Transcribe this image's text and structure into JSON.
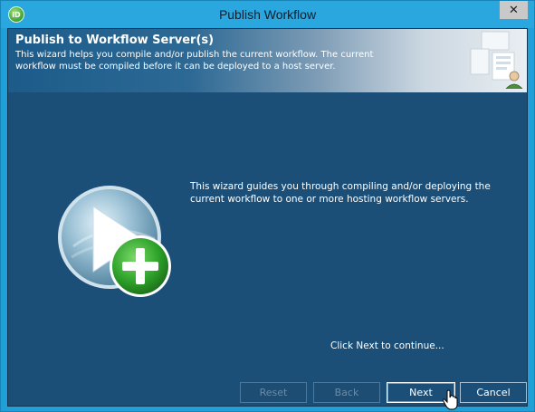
{
  "window": {
    "title": "Publish Workflow",
    "app_icon_text": "iD",
    "close_glyph": "✕"
  },
  "header": {
    "title": "Publish to Workflow Server(s)",
    "description": "This wizard helps you compile and/or publish the current workflow. The current workflow must be compiled before it can be deployed to a host server."
  },
  "body": {
    "guide_text": "This wizard guides you through compiling and/or deploying the current workflow to one or more hosting workflow servers.",
    "continue_text": "Click Next to continue..."
  },
  "buttons": {
    "reset": "Reset",
    "back": "Back",
    "next": "Next",
    "cancel": "Cancel"
  },
  "colors": {
    "titlebar": "#2aa7df",
    "client_bg": "#1b4f78",
    "accent_green": "#3aa234"
  },
  "icons": [
    "app-icon",
    "close-icon",
    "header-servers-icon",
    "play-add-icon",
    "mouse-cursor-icon"
  ]
}
